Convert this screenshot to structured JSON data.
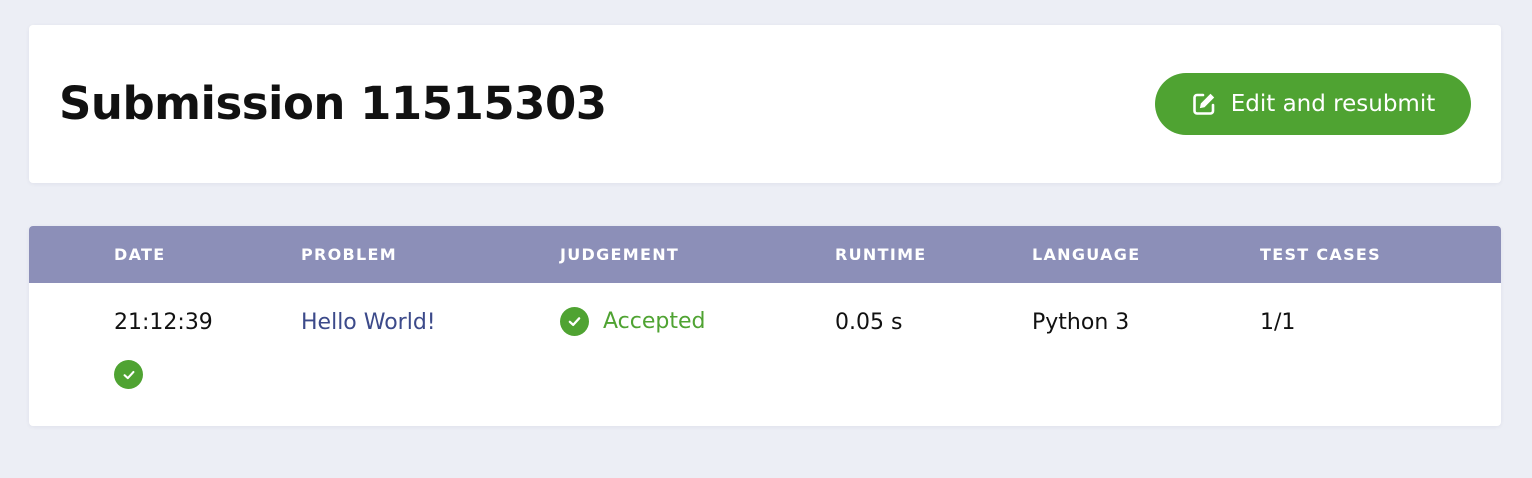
{
  "header": {
    "title": "Submission 11515303",
    "resubmit_label": "Edit and resubmit",
    "resubmit_icon": "edit-icon",
    "accent_color": "#4fa332"
  },
  "table": {
    "header_color": "#8c8fb8",
    "columns": [
      "DATE",
      "PROBLEM",
      "JUDGEMENT",
      "RUNTIME",
      "LANGUAGE",
      "TEST CASES"
    ],
    "rows": [
      {
        "date": "21:12:39",
        "problem": "Hello World!",
        "judgement": "Accepted",
        "judgement_icon": "check-circle-icon",
        "runtime": "0.05 s",
        "language": "Python 3",
        "test_cases": "1/1",
        "testcase_icons": [
          "check-circle-icon"
        ]
      }
    ]
  }
}
